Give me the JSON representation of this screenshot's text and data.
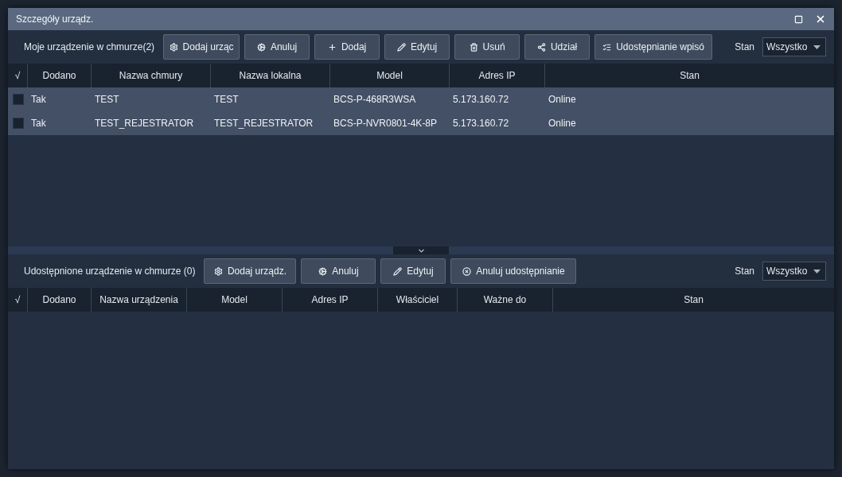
{
  "window": {
    "title": "Szczegóły urządz."
  },
  "cloud_devices": {
    "title": "Moje urządzenie w chmurze(2)",
    "buttons": [
      {
        "kind": "gear",
        "label": "Dodaj urząc"
      },
      {
        "kind": "gears",
        "label": "Anuluj"
      },
      {
        "kind": "plus",
        "label": "Dodaj"
      },
      {
        "kind": "pencil",
        "label": "Edytuj"
      },
      {
        "kind": "trash",
        "label": "Usuń"
      },
      {
        "kind": "share",
        "label": "Udział"
      },
      {
        "kind": "list",
        "label": "Udostępnianie wpisó"
      }
    ],
    "filter": {
      "label": "Stan",
      "value": "Wszystko"
    },
    "table": {
      "check_header": "√",
      "columns": [
        "Dodano",
        "Nazwa chmury",
        "Nazwa lokalna",
        "Model",
        "Adres IP",
        "Stan"
      ],
      "rows": [
        {
          "checked": false,
          "cells": [
            "Tak",
            "TEST",
            "TEST",
            "BCS-P-468R3WSA",
            "5.173.160.72",
            "Online"
          ]
        },
        {
          "checked": false,
          "cells": [
            "Tak",
            "TEST_REJESTRATOR",
            "TEST_REJESTRATOR",
            "BCS-P-NVR0801-4K-8P",
            "5.173.160.72",
            "Online"
          ]
        }
      ]
    }
  },
  "shared_devices": {
    "title": "Udostępnione urządzenie w chmurze (0)",
    "buttons": [
      {
        "kind": "gear",
        "label": "Dodaj urządz."
      },
      {
        "kind": "gears",
        "label": "Anuluj"
      },
      {
        "kind": "pencil",
        "label": "Edytuj"
      },
      {
        "kind": "cancel",
        "label": "Anuluj udostępnianie"
      }
    ],
    "filter": {
      "label": "Stan",
      "value": "Wszystko"
    },
    "table": {
      "check_header": "√",
      "columns": [
        "Dodano",
        "Nazwa urządzenia",
        "Model",
        "Adres IP",
        "Właściciel",
        "Ważne do",
        "Stan"
      ]
    }
  }
}
